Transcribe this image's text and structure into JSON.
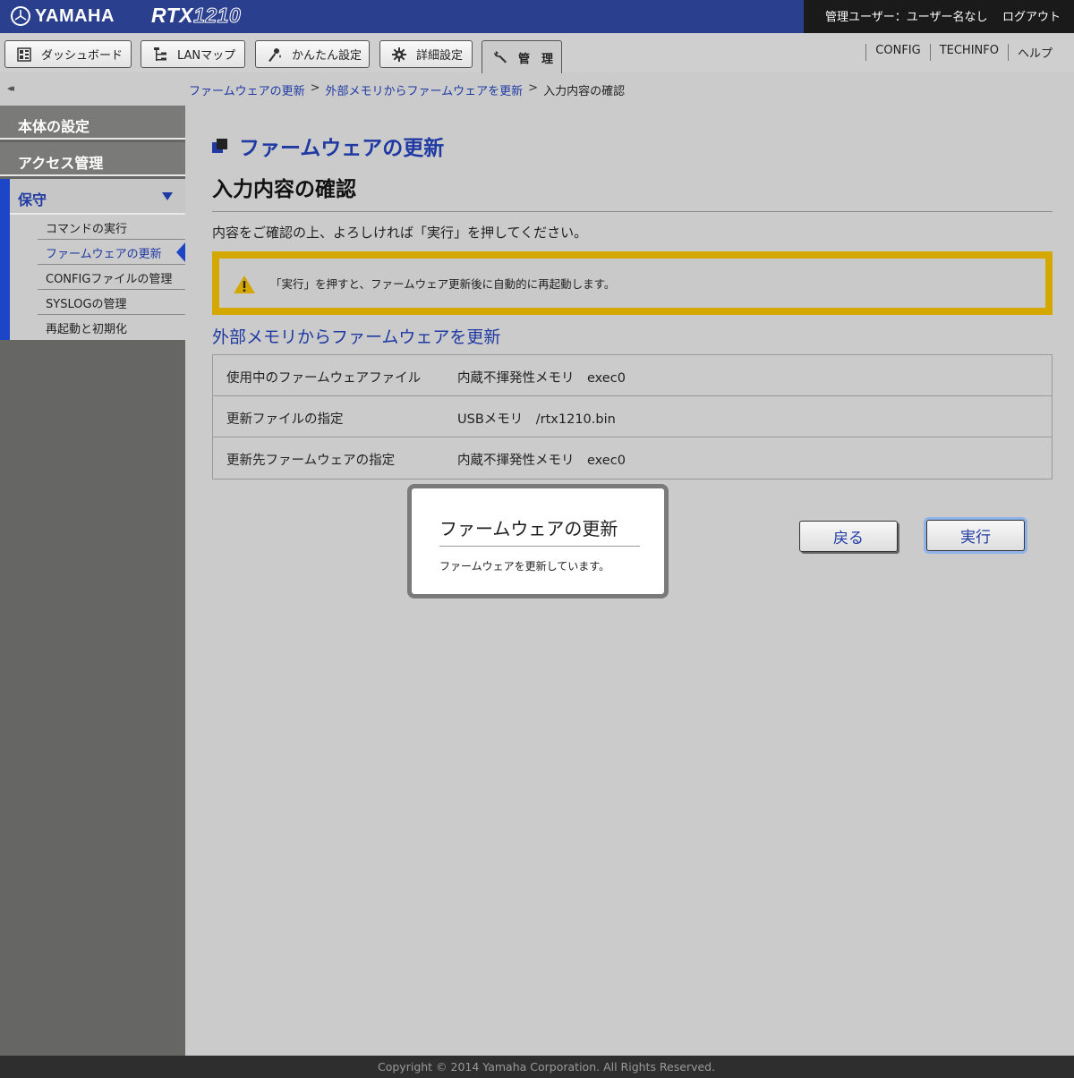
{
  "header": {
    "brand": "YAMAHA",
    "model_prefix": "RTX",
    "model_number": "1210",
    "user_label": "管理ユーザー：ユーザー名なし",
    "logout_label": "ログアウト",
    "bg_color": "#2b3f8f"
  },
  "nav": {
    "tabs": [
      {
        "label": "ダッシュボード",
        "icon": "dashboard-icon"
      },
      {
        "label": "LANマップ",
        "icon": "lan-map-icon"
      },
      {
        "label": "かんたん設定",
        "icon": "wizard-icon"
      },
      {
        "label": "詳細設定",
        "icon": "gear-icon"
      },
      {
        "label": "管　理",
        "icon": "wrench-icon",
        "active": true
      }
    ],
    "links": [
      "CONFIG",
      "TECHINFO",
      "ヘルプ"
    ]
  },
  "breadcrumb": {
    "items": [
      "ファームウェアの更新",
      "外部メモリからファームウェアを更新"
    ],
    "separator": ">",
    "current": "入力内容の確認"
  },
  "sidebar": {
    "collapse_label": "◂◂",
    "items": [
      "本体の設定",
      "アクセス管理"
    ],
    "active_section": "保守",
    "subitems": [
      "コマンドの実行",
      "ファームウェアの更新",
      "CONFIGファイルの管理",
      "SYSLOGの管理",
      "再起動と初期化"
    ],
    "current_subitem": "ファームウェアの更新"
  },
  "main": {
    "title": "ファームウェアの更新",
    "subtitle": "入力内容の確認",
    "instruction": "内容をご確認の上、よろしければ「実行」を押してください。",
    "warning": "「実行」を押すと、ファームウェア更新後に自動的に再起動します。",
    "section_title": "外部メモリからファームウェアを更新",
    "rows": [
      {
        "key": "使用中のファームウェアファイル",
        "value": "内蔵不揮発性メモリ　exec0"
      },
      {
        "key": "更新ファイルの指定",
        "value": "USBメモリ　/rtx1210.bin"
      },
      {
        "key": "更新先ファームウェアの指定",
        "value": "内蔵不揮発性メモリ　exec0"
      }
    ],
    "back_label": "戻る",
    "execute_label": "実行"
  },
  "modal": {
    "title": "ファームウェアの更新",
    "message": "ファームウェアを更新しています。"
  },
  "footer": {
    "copyright": "Copyright © 2014 Yamaha Corporation. All Rights Reserved."
  },
  "colors": {
    "accent": "#1f3aa3",
    "warning_border": "#d4a800",
    "sidebar_bg": "#666665"
  }
}
